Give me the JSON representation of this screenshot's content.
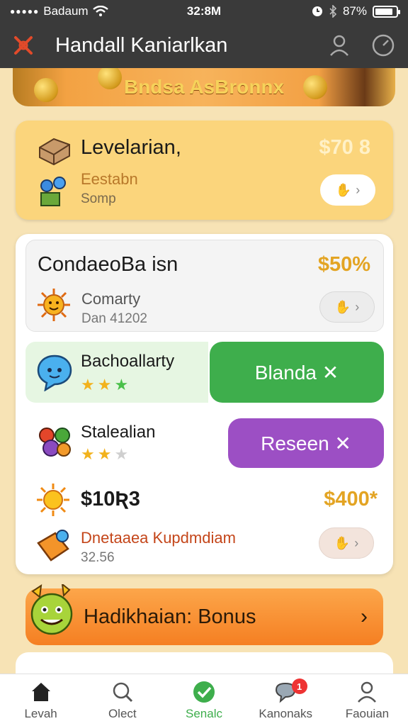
{
  "status_bar": {
    "carrier": "Badaum",
    "time": "32:8M",
    "battery": "87%"
  },
  "header": {
    "title": "Handall Kaniarlkan"
  },
  "banner": {
    "text": "Bndsa AsBronnx"
  },
  "card1": {
    "title": "Levelarian,",
    "amount": "$70 8",
    "subtitle": "Eestabn",
    "meta": "Somp"
  },
  "card2": {
    "title": "CondaeoBa isn",
    "amount": "$50%",
    "subtitle": "Comarty",
    "meta": "Dan 41202"
  },
  "challenge1": {
    "title": "Bachoallarty",
    "stars": 3,
    "button_label": "Blanda ✕"
  },
  "challenge2": {
    "title": "Stalealian",
    "stars": 2,
    "button_label": "Reseen ✕"
  },
  "reward": {
    "title": "$10Ʀ3",
    "amount": "$400*",
    "subtitle": "Dnetaaea Kupdmdiam",
    "meta": "32.56"
  },
  "bonus": {
    "title": "Hadikhaian: Bonus",
    "chevron": "›"
  },
  "tabs": [
    {
      "label": "Levah",
      "icon": "home-icon"
    },
    {
      "label": "Olect",
      "icon": "search-icon"
    },
    {
      "label": "Senalc",
      "icon": "check-icon",
      "active": true
    },
    {
      "label": "Kanonaks",
      "icon": "chat-icon",
      "badge": "1"
    },
    {
      "label": "Faouian",
      "icon": "profile-icon"
    }
  ],
  "colors": {
    "accent_green": "#3eae4c",
    "accent_purple": "#9c4fc4",
    "amount_gold": "#e3a423",
    "bonus_orange": "#f57f22"
  }
}
